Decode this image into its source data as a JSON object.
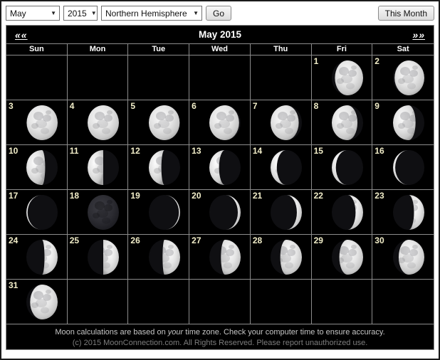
{
  "toolbar": {
    "month_select": {
      "value": "May"
    },
    "year_select": {
      "value": "2015"
    },
    "hemisphere_select": {
      "value": "Northern Hemisphere"
    },
    "go_label": "Go",
    "this_month_label": "This Month"
  },
  "calendar": {
    "title": "May 2015",
    "prev_label": "««",
    "next_label": "»»",
    "day_headers": [
      "Sun",
      "Mon",
      "Tue",
      "Wed",
      "Thu",
      "Fri",
      "Sat"
    ],
    "weeks": [
      [
        null,
        null,
        null,
        null,
        null,
        {
          "day": 1,
          "phase": "waxing-gibbous",
          "lit_fraction": 0.9,
          "lit_side": "right"
        },
        {
          "day": 2,
          "phase": "waxing-gibbous",
          "lit_fraction": 0.95,
          "lit_side": "right"
        }
      ],
      [
        {
          "day": 3,
          "phase": "full-moon",
          "lit_fraction": 0.99,
          "lit_side": "right"
        },
        {
          "day": 4,
          "phase": "full-moon",
          "lit_fraction": 1.0,
          "lit_side": "none"
        },
        {
          "day": 5,
          "phase": "waning-gibbous",
          "lit_fraction": 0.985,
          "lit_side": "left"
        },
        {
          "day": 6,
          "phase": "waning-gibbous",
          "lit_fraction": 0.95,
          "lit_side": "left"
        },
        {
          "day": 7,
          "phase": "waning-gibbous",
          "lit_fraction": 0.9,
          "lit_side": "left"
        },
        {
          "day": 8,
          "phase": "waning-gibbous",
          "lit_fraction": 0.82,
          "lit_side": "left"
        },
        {
          "day": 9,
          "phase": "waning-gibbous",
          "lit_fraction": 0.72,
          "lit_side": "left"
        }
      ],
      [
        {
          "day": 10,
          "phase": "waning-gibbous",
          "lit_fraction": 0.6,
          "lit_side": "left"
        },
        {
          "day": 11,
          "phase": "last-quarter",
          "lit_fraction": 0.5,
          "lit_side": "left"
        },
        {
          "day": 12,
          "phase": "waning-crescent",
          "lit_fraction": 0.4,
          "lit_side": "left"
        },
        {
          "day": 13,
          "phase": "waning-crescent",
          "lit_fraction": 0.31,
          "lit_side": "left"
        },
        {
          "day": 14,
          "phase": "waning-crescent",
          "lit_fraction": 0.2,
          "lit_side": "left"
        },
        {
          "day": 15,
          "phase": "waning-crescent",
          "lit_fraction": 0.13,
          "lit_side": "left"
        },
        {
          "day": 16,
          "phase": "waning-crescent",
          "lit_fraction": 0.07,
          "lit_side": "left"
        }
      ],
      [
        {
          "day": 17,
          "phase": "waning-crescent",
          "lit_fraction": 0.04,
          "lit_side": "left"
        },
        {
          "day": 18,
          "phase": "new-moon",
          "lit_fraction": 0.0,
          "lit_side": "none"
        },
        {
          "day": 19,
          "phase": "waxing-crescent",
          "lit_fraction": 0.04,
          "lit_side": "right"
        },
        {
          "day": 20,
          "phase": "waxing-crescent",
          "lit_fraction": 0.09,
          "lit_side": "right"
        },
        {
          "day": 21,
          "phase": "waxing-crescent",
          "lit_fraction": 0.16,
          "lit_side": "right"
        },
        {
          "day": 22,
          "phase": "waxing-crescent",
          "lit_fraction": 0.24,
          "lit_side": "right"
        },
        {
          "day": 23,
          "phase": "waxing-crescent",
          "lit_fraction": 0.33,
          "lit_side": "right"
        }
      ],
      [
        {
          "day": 24,
          "phase": "waxing-crescent",
          "lit_fraction": 0.42,
          "lit_side": "right"
        },
        {
          "day": 25,
          "phase": "first-quarter",
          "lit_fraction": 0.5,
          "lit_side": "right"
        },
        {
          "day": 26,
          "phase": "waxing-gibbous",
          "lit_fraction": 0.56,
          "lit_side": "right"
        },
        {
          "day": 27,
          "phase": "waxing-gibbous",
          "lit_fraction": 0.63,
          "lit_side": "right"
        },
        {
          "day": 28,
          "phase": "waxing-gibbous",
          "lit_fraction": 0.69,
          "lit_side": "right"
        },
        {
          "day": 29,
          "phase": "waxing-gibbous",
          "lit_fraction": 0.76,
          "lit_side": "right"
        },
        {
          "day": 30,
          "phase": "waxing-gibbous",
          "lit_fraction": 0.82,
          "lit_side": "right"
        }
      ],
      [
        {
          "day": 31,
          "phase": "waxing-gibbous",
          "lit_fraction": 0.88,
          "lit_side": "right"
        },
        null,
        null,
        null,
        null,
        null,
        null
      ]
    ]
  },
  "footer": {
    "line1_parts": [
      "Moon calculations are based on ",
      "your",
      " time zone. Check your computer time to ensure accuracy."
    ],
    "line2": "(c) 2015 MoonConnection.com. All Rights Reserved. Please report unauthorized use."
  },
  "colors": {
    "calendar_bg": "#000000",
    "grid_line": "#8c8c8c",
    "date_number": "#f2eec9",
    "header_text": "#ffffff",
    "footer_primary": "#c6c6c6",
    "footer_secondary": "#7d7d7d"
  }
}
